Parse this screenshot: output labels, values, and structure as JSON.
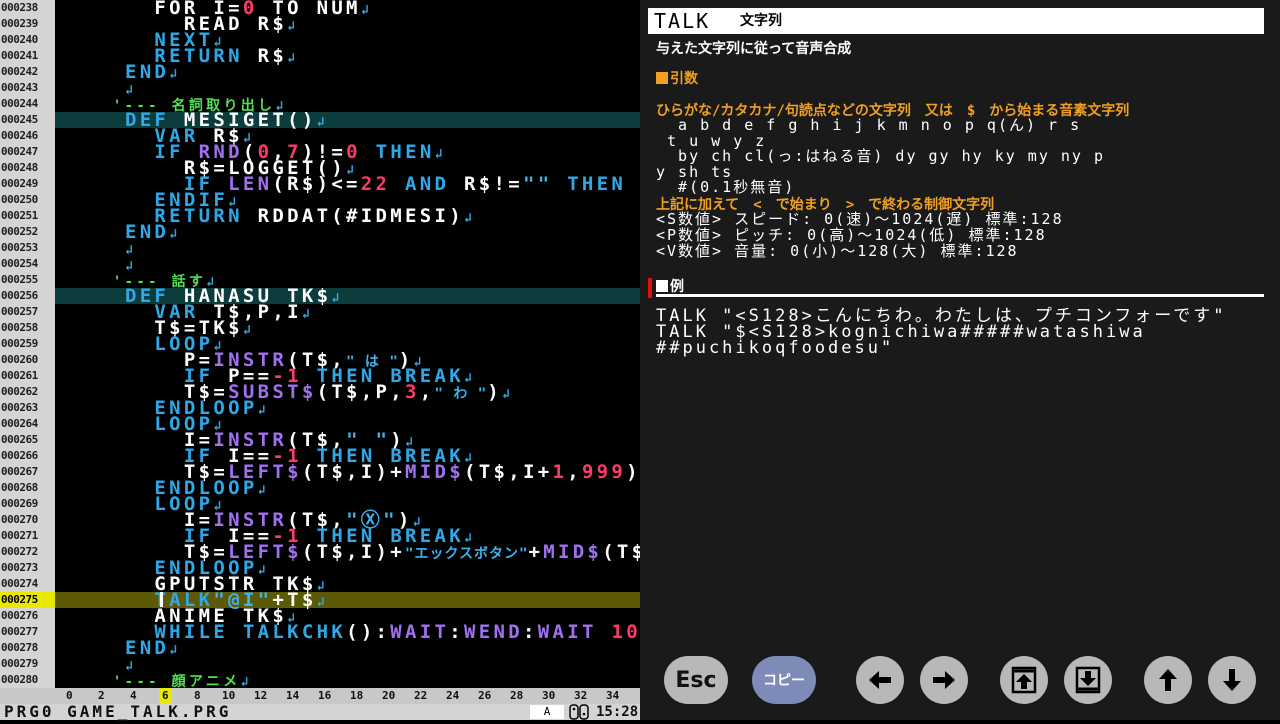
{
  "editor": {
    "lines": [
      {
        "n": "000238",
        "code": [
          [
            "      FOR I=",
            ""
          ],
          [
            "0",
            "num"
          ],
          [
            " TO NUM",
            ""
          ],
          [
            "↲",
            "ret"
          ]
        ]
      },
      {
        "n": "000239",
        "code": [
          [
            "        READ R$",
            ""
          ],
          [
            "↲",
            "ret"
          ]
        ]
      },
      {
        "n": "000240",
        "code": [
          [
            "      NEXT",
            "kw"
          ],
          [
            "↲",
            "ret"
          ]
        ]
      },
      {
        "n": "000241",
        "code": [
          [
            "      RETURN",
            "kw"
          ],
          [
            " R$",
            ""
          ],
          [
            "↲",
            "ret"
          ]
        ]
      },
      {
        "n": "000242",
        "code": [
          [
            "    END",
            "kw"
          ],
          [
            "↲",
            "ret"
          ]
        ]
      },
      {
        "n": "000243",
        "code": [
          [
            "    ",
            ""
          ],
          [
            "↲",
            "ret"
          ]
        ]
      },
      {
        "n": "000244",
        "code": [
          [
            "    '--- ",
            "cmt"
          ],
          [
            "名詞取り出し",
            "cmt"
          ],
          [
            "↲",
            "ret"
          ]
        ]
      },
      {
        "n": "000245",
        "code": [
          [
            "    DEF",
            "kw"
          ],
          [
            " MESIGET()",
            ""
          ],
          [
            "↲",
            "ret"
          ]
        ],
        "hl": "teal"
      },
      {
        "n": "000246",
        "code": [
          [
            "      VAR",
            "kw"
          ],
          [
            " R$",
            ""
          ],
          [
            "↲",
            "ret"
          ]
        ]
      },
      {
        "n": "000247",
        "code": [
          [
            "      IF",
            "kw"
          ],
          [
            " ",
            ""
          ],
          [
            "RND",
            "fn"
          ],
          [
            "(",
            ""
          ],
          [
            "0",
            "num"
          ],
          [
            ",",
            ""
          ],
          [
            "7",
            "num"
          ],
          [
            ")!=",
            ""
          ],
          [
            "0",
            "num"
          ],
          [
            " ",
            ""
          ],
          [
            "THEN",
            "kw"
          ],
          [
            "↲",
            "ret"
          ]
        ]
      },
      {
        "n": "000248",
        "code": [
          [
            "        R$=LOGGET()",
            ""
          ],
          [
            "↲",
            "ret"
          ]
        ]
      },
      {
        "n": "000249",
        "code": [
          [
            "        IF",
            "kw"
          ],
          [
            " ",
            ""
          ],
          [
            "LEN",
            "fn"
          ],
          [
            "(R$)<=",
            ""
          ],
          [
            "22",
            "num"
          ],
          [
            " ",
            ""
          ],
          [
            "AND",
            "kw"
          ],
          [
            " R$!=",
            ""
          ],
          [
            "\"\"",
            "str"
          ],
          [
            " ",
            ""
          ],
          [
            "THEN",
            "kw"
          ],
          [
            " R",
            ""
          ]
        ]
      },
      {
        "n": "000250",
        "code": [
          [
            "      ENDIF",
            "kw"
          ],
          [
            "↲",
            "ret"
          ]
        ]
      },
      {
        "n": "000251",
        "code": [
          [
            "      RETURN",
            "kw"
          ],
          [
            " RDDAT(#IDMESI)",
            ""
          ],
          [
            "↲",
            "ret"
          ]
        ]
      },
      {
        "n": "000252",
        "code": [
          [
            "    END",
            "kw"
          ],
          [
            "↲",
            "ret"
          ]
        ]
      },
      {
        "n": "000253",
        "code": [
          [
            "    ",
            ""
          ],
          [
            "↲",
            "ret"
          ]
        ]
      },
      {
        "n": "000254",
        "code": [
          [
            "    ",
            ""
          ],
          [
            "↲",
            "ret"
          ]
        ]
      },
      {
        "n": "000255",
        "code": [
          [
            "    '--- ",
            "cmt"
          ],
          [
            "話す",
            "cmt"
          ],
          [
            "↲",
            "ret"
          ]
        ]
      },
      {
        "n": "000256",
        "code": [
          [
            "    DEF",
            "kw"
          ],
          [
            " HANASU TK$",
            ""
          ],
          [
            "↲",
            "ret"
          ]
        ],
        "hl": "teal"
      },
      {
        "n": "000257",
        "code": [
          [
            "      VAR",
            "kw"
          ],
          [
            " T$,P,I",
            ""
          ],
          [
            "↲",
            "ret"
          ]
        ]
      },
      {
        "n": "000258",
        "code": [
          [
            "      T$=TK$",
            ""
          ],
          [
            "↲",
            "ret"
          ]
        ]
      },
      {
        "n": "000259",
        "code": [
          [
            "      LOOP",
            "kw"
          ],
          [
            "↲",
            "ret"
          ]
        ]
      },
      {
        "n": "000260",
        "code": [
          [
            "        P=",
            ""
          ],
          [
            "INSTR",
            "fn"
          ],
          [
            "(T$,",
            ""
          ],
          [
            "\" は \"",
            "str"
          ],
          [
            ")",
            ""
          ],
          [
            "↲",
            "ret"
          ]
        ]
      },
      {
        "n": "000261",
        "code": [
          [
            "        IF",
            "kw"
          ],
          [
            " P==",
            ""
          ],
          [
            "-1",
            "num"
          ],
          [
            " ",
            ""
          ],
          [
            "THEN",
            "kw"
          ],
          [
            " ",
            ""
          ],
          [
            "BREAK",
            "kw"
          ],
          [
            "↲",
            "ret"
          ]
        ]
      },
      {
        "n": "000262",
        "code": [
          [
            "        T$=",
            ""
          ],
          [
            "SUBST$",
            "fn"
          ],
          [
            "(T$,P,",
            ""
          ],
          [
            "3",
            "num"
          ],
          [
            ",",
            ""
          ],
          [
            "\" わ \"",
            "str"
          ],
          [
            ")",
            ""
          ],
          [
            "↲",
            "ret"
          ]
        ]
      },
      {
        "n": "000263",
        "code": [
          [
            "      ENDLOOP",
            "kw"
          ],
          [
            "↲",
            "ret"
          ]
        ]
      },
      {
        "n": "000264",
        "code": [
          [
            "      LOOP",
            "kw"
          ],
          [
            "↲",
            "ret"
          ]
        ]
      },
      {
        "n": "000265",
        "code": [
          [
            "        I=",
            ""
          ],
          [
            "INSTR",
            "fn"
          ],
          [
            "(T$,",
            ""
          ],
          [
            "\" \"",
            "str"
          ],
          [
            ")",
            ""
          ],
          [
            "↲",
            "ret"
          ]
        ]
      },
      {
        "n": "000266",
        "code": [
          [
            "        IF",
            "kw"
          ],
          [
            " I==",
            ""
          ],
          [
            "-1",
            "num"
          ],
          [
            " ",
            ""
          ],
          [
            "THEN",
            "kw"
          ],
          [
            " ",
            ""
          ],
          [
            "BREAK",
            "kw"
          ],
          [
            "↲",
            "ret"
          ]
        ]
      },
      {
        "n": "000267",
        "code": [
          [
            "        T$=",
            ""
          ],
          [
            "LEFT$",
            "fn"
          ],
          [
            "(T$,I)+",
            ""
          ],
          [
            "MID$",
            "fn"
          ],
          [
            "(T$,I+",
            ""
          ],
          [
            "1",
            "num"
          ],
          [
            ",",
            ""
          ],
          [
            "999",
            "num"
          ],
          [
            ")",
            ""
          ],
          [
            "↲",
            "ret"
          ]
        ]
      },
      {
        "n": "000268",
        "code": [
          [
            "      ENDLOOP",
            "kw"
          ],
          [
            "↲",
            "ret"
          ]
        ]
      },
      {
        "n": "000269",
        "code": [
          [
            "      LOOP",
            "kw"
          ],
          [
            "↲",
            "ret"
          ]
        ]
      },
      {
        "n": "000270",
        "code": [
          [
            "        I=",
            ""
          ],
          [
            "INSTR",
            "fn"
          ],
          [
            "(T$,",
            ""
          ],
          [
            "\"Ⓧ\"",
            "str"
          ],
          [
            ")",
            ""
          ],
          [
            "↲",
            "ret"
          ]
        ]
      },
      {
        "n": "000271",
        "code": [
          [
            "        IF",
            "kw"
          ],
          [
            " I==",
            ""
          ],
          [
            "-1",
            "num"
          ],
          [
            " ",
            ""
          ],
          [
            "THEN",
            "kw"
          ],
          [
            " ",
            ""
          ],
          [
            "BREAK",
            "kw"
          ],
          [
            "↲",
            "ret"
          ]
        ]
      },
      {
        "n": "000272",
        "code": [
          [
            "        T$=",
            ""
          ],
          [
            "LEFT$",
            "fn"
          ],
          [
            "(T$,I)+",
            ""
          ],
          [
            "\"エックスボタン\"",
            "str"
          ],
          [
            "+",
            ""
          ],
          [
            "MID$",
            "fn"
          ],
          [
            "(T$",
            ""
          ]
        ]
      },
      {
        "n": "000273",
        "code": [
          [
            "      ENDLOOP",
            "kw"
          ],
          [
            "↲",
            "ret"
          ]
        ]
      },
      {
        "n": "000274",
        "code": [
          [
            "      GPUTSTR TK$",
            ""
          ],
          [
            "↲",
            "ret"
          ]
        ]
      },
      {
        "n": "000275",
        "code": [
          [
            "      TALK",
            "kw"
          ],
          [
            "\"@I\"",
            "str"
          ],
          [
            "+T$",
            ""
          ],
          [
            "↲",
            "ret"
          ]
        ],
        "hl": "cur"
      },
      {
        "n": "000276",
        "code": [
          [
            "      ANIME TK$",
            ""
          ],
          [
            "↲",
            "ret"
          ]
        ]
      },
      {
        "n": "000277",
        "code": [
          [
            "      WHILE",
            "kw"
          ],
          [
            " ",
            ""
          ],
          [
            "TALKCHK",
            "kw"
          ],
          [
            "():",
            ""
          ],
          [
            "WAIT",
            "fn"
          ],
          [
            ":",
            ""
          ],
          [
            "WEND",
            "fn"
          ],
          [
            ":",
            ""
          ],
          [
            "WAIT",
            "fn"
          ],
          [
            " ",
            ""
          ],
          [
            "10",
            "num"
          ],
          [
            "↲",
            "ret"
          ]
        ]
      },
      {
        "n": "000278",
        "code": [
          [
            "    END",
            "kw"
          ],
          [
            "↲",
            "ret"
          ]
        ]
      },
      {
        "n": "000279",
        "code": [
          [
            "    ",
            ""
          ],
          [
            "↲",
            "ret"
          ]
        ]
      },
      {
        "n": "000280",
        "code": [
          [
            "    '--- ",
            "cmt"
          ],
          [
            "顔アニメ",
            "cmt"
          ],
          [
            "↲",
            "ret"
          ]
        ]
      }
    ],
    "ruler": [
      "0",
      "2",
      "4",
      "6",
      "8",
      "10",
      "12",
      "14",
      "16",
      "18",
      "20",
      "22",
      "24",
      "26",
      "28",
      "30",
      "32",
      "34"
    ],
    "ruler_active": "6",
    "status": {
      "file": "PRG0 GAME_TALK.PRG",
      "mode": "A",
      "clock": "15:28"
    }
  },
  "help": {
    "command": "TALK",
    "arg": "文字列",
    "description": "与えた文字列に従って音声合成",
    "args_head": "引数",
    "arg_line1": "ひらがな/カタカナ/句読点などの文字列　又は　$　から始まる音素文字列",
    "phonemes": [
      "  a b d e f g h i j k m n o p q(ん) r s",
      " t u w y z",
      "  by ch cl(っ:はねる音) dy gy hy ky my ny p",
      "y sh ts",
      "  #(0.1秒無音)"
    ],
    "ctrl_head": "上記に加えて　<　で始まり　>　で終わる制御文字列",
    "params": [
      "<S数値> スピード: 0(速)〜1024(遅) 標準:128",
      "<P数値> ピッチ: 0(高)〜1024(低) 標準:128",
      "<V数値> 音量: 0(小)〜128(大) 標準:128"
    ],
    "example_head": "例",
    "examples": [
      "TALK \"<S128>こんにちわ。わたしは、プチコンフォーです\"",
      "TALK \"$<S128>kognichiwa#####watashiwa",
      "##puchikoqfoodesu\""
    ]
  },
  "buttons": {
    "esc": "Esc",
    "copy": "コピー",
    "left_icon": "arrow-left-icon",
    "right_icon": "arrow-right-icon",
    "page_up_icon": "page-up-icon",
    "page_down_icon": "page-down-icon",
    "up_icon": "arrow-up-icon",
    "down_icon": "arrow-down-icon"
  }
}
